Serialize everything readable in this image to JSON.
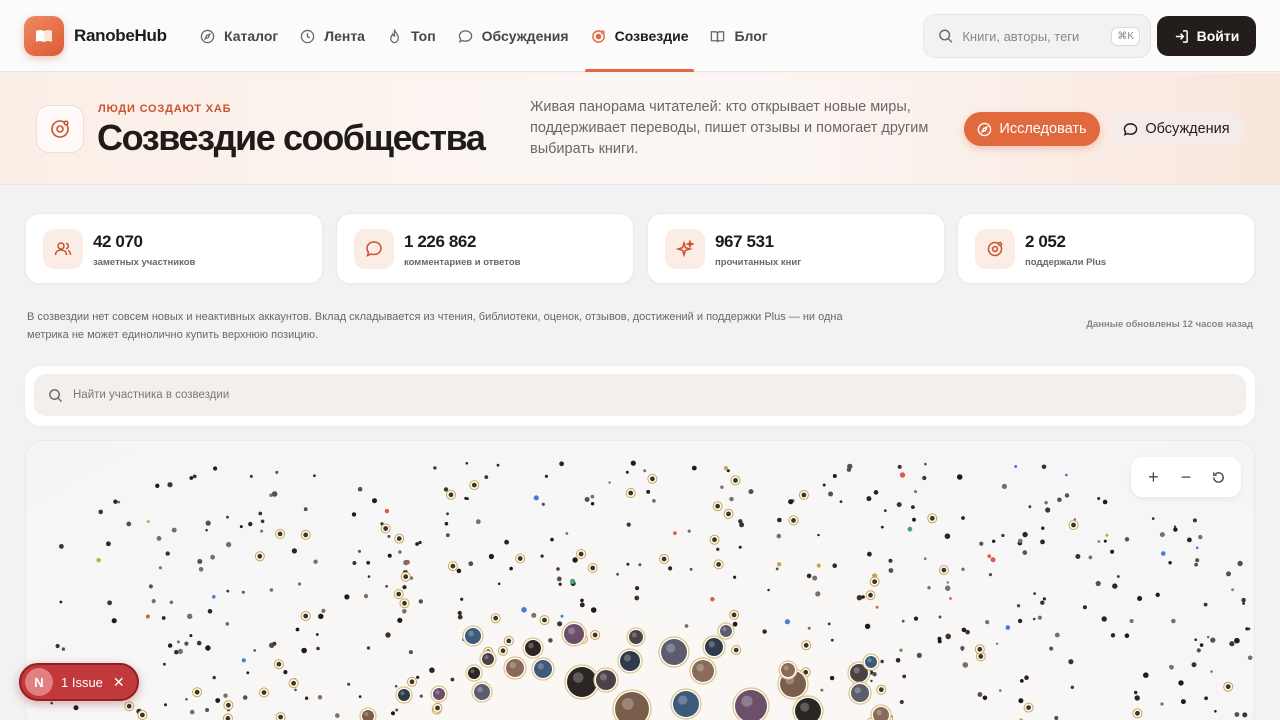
{
  "brand": {
    "name": "RanobeHub"
  },
  "nav": [
    {
      "label": "Каталог",
      "icon": "compass-icon"
    },
    {
      "label": "Лента",
      "icon": "clock-icon"
    },
    {
      "label": "Топ",
      "icon": "flame-icon"
    },
    {
      "label": "Обсуждения",
      "icon": "chat-icon"
    },
    {
      "label": "Созвездие",
      "icon": "constellation-icon",
      "active": true
    },
    {
      "label": "Блог",
      "icon": "book-icon"
    }
  ],
  "search": {
    "placeholder": "Книги, авторы, теги",
    "shortcut": "⌘K"
  },
  "login": {
    "label": "Войти"
  },
  "hero": {
    "eyebrow": "ЛЮДИ СОЗДАЮТ ХАБ",
    "title": "Созвездие сообщества",
    "description": "Живая панорама читателей: кто открывает новые миры, поддерживает переводы, пишет отзывы и помогает другим выбирать книги.",
    "explore_label": "Исследовать",
    "discuss_label": "Обсуждения"
  },
  "stats": [
    {
      "value": "42 070",
      "label": "заметных участников",
      "icon": "users-icon"
    },
    {
      "value": "1 226 862",
      "label": "комментариев и ответов",
      "icon": "comment-icon"
    },
    {
      "value": "967 531",
      "label": "прочитанных книг",
      "icon": "sparkles-icon"
    },
    {
      "value": "2 052",
      "label": "поддержали Plus",
      "icon": "orbit-icon"
    }
  ],
  "note": "В созвездии нет совсем новых и неактивных аккаунтов. Вклад складывается из чтения, библиотеки, оценок, отзывов, достижений и поддержки Plus — ни одна метрика не может единолично купить верхнюю позицию.",
  "updated": "Данные обновлены 12 часов назад",
  "member_search": {
    "placeholder": "Найти участника в созвездии"
  },
  "zoom": {
    "zoom_in": "+",
    "zoom_out": "−"
  },
  "issue": {
    "badge": "N",
    "label": "1 Issue"
  },
  "colors": {
    "accent": "#e2683e",
    "dark": "#231d1b",
    "gold": "#c9a54a"
  }
}
